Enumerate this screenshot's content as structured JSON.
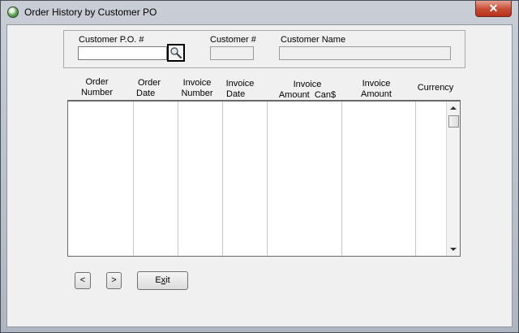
{
  "window": {
    "title": "Order History by Customer PO",
    "close_label": "✕"
  },
  "filters": {
    "po_label": "Customer P.O. #",
    "po_value": "",
    "customer_num_label": "Customer #",
    "customer_num_value": "",
    "customer_name_label": "Customer Name",
    "customer_name_value": ""
  },
  "grid": {
    "columns": [
      {
        "line1": "Order",
        "line2": "Number"
      },
      {
        "line1": "Order",
        "line2": "Date"
      },
      {
        "line1": "Invoice",
        "line2": "Number"
      },
      {
        "line1": "Invoice",
        "line2": "Date"
      },
      {
        "line1": "Invoice",
        "line2": "Amount  Can$"
      },
      {
        "line1": "Invoice",
        "line2": "Amount"
      },
      {
        "line1": "",
        "line2": "Currency"
      }
    ],
    "rows": []
  },
  "buttons": {
    "prev": "<",
    "next": ">",
    "exit_prefix": "E",
    "exit_underline": "x",
    "exit_suffix": "it"
  },
  "colors": {
    "title_bar": "#b9c0cb",
    "close_button": "#c74a33"
  }
}
